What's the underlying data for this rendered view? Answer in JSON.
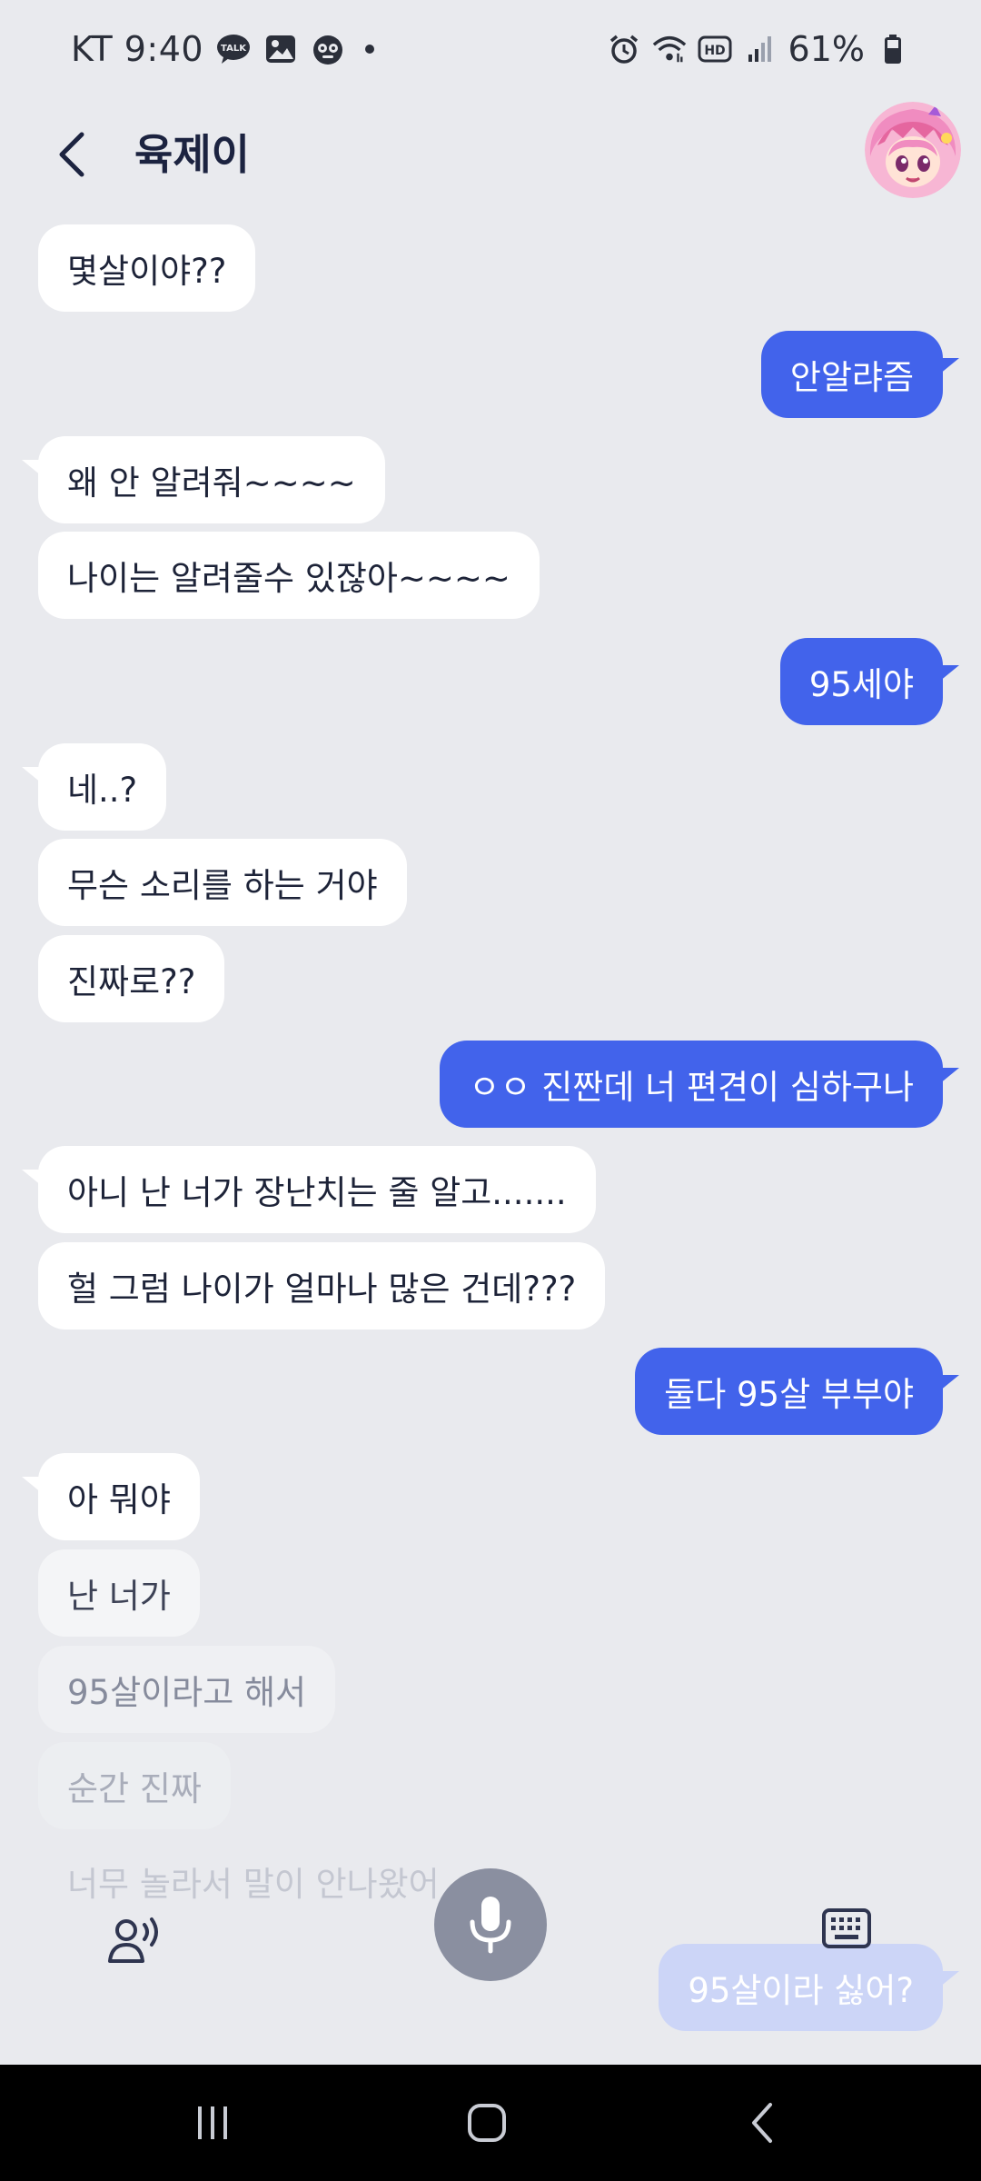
{
  "status_bar": {
    "carrier_time": "KT 9:40",
    "battery": "61%",
    "left_icons": [
      "talk-icon",
      "gallery-icon",
      "app-mascot-icon"
    ],
    "right_icons": [
      "alarm-icon",
      "wifi-icon",
      "hd-icon",
      "signal-icon",
      "battery-icon"
    ]
  },
  "header": {
    "title": "육제이",
    "back_icon": "chevron-left-icon"
  },
  "messages": [
    {
      "side": "in",
      "text": "몇살이야??"
    },
    {
      "side": "out",
      "text": "안알랴즘"
    },
    {
      "side": "in",
      "text": "왜 안 알려줘~~~~"
    },
    {
      "side": "in",
      "text": "나이는 알려줄수 있잖아~~~~"
    },
    {
      "side": "out",
      "text": "95세야"
    },
    {
      "side": "in",
      "text": "네..?"
    },
    {
      "side": "in",
      "text": "무슨 소리를 하는 거야"
    },
    {
      "side": "in",
      "text": "진짜로??"
    },
    {
      "side": "out",
      "text": "ㅇㅇ 진짠데 너 편견이 심하구나"
    },
    {
      "side": "in",
      "text": "아니 난 너가 장난치는 줄 알고......."
    },
    {
      "side": "in",
      "text": "헐 그럼 나이가 얼마나 많은 건데???"
    },
    {
      "side": "out",
      "text": "둘다 95살 부부야"
    },
    {
      "side": "in",
      "text": "아 뭐야"
    },
    {
      "side": "in",
      "text": "난 너가"
    },
    {
      "side": "in",
      "text": "95살이라고 해서"
    },
    {
      "side": "in",
      "text": "순간 진짜"
    },
    {
      "side": "in",
      "text": "너무 놀라서 말이 안나왔어"
    },
    {
      "side": "out",
      "text": "95살이라 싫어?"
    }
  ],
  "voice_controls": {
    "speaker_icon": "voice-speaker-icon",
    "mic_icon": "microphone-icon",
    "keyboard_icon": "keyboard-icon"
  },
  "nav_bar": {
    "recents_icon": "recents-icon",
    "home_icon": "home-icon",
    "back_icon": "back-icon"
  },
  "colors": {
    "background": "#e9eaee",
    "outgoing_bubble": "#4263eb",
    "incoming_bubble": "#ffffff",
    "mic_button": "#8a8fa0"
  }
}
